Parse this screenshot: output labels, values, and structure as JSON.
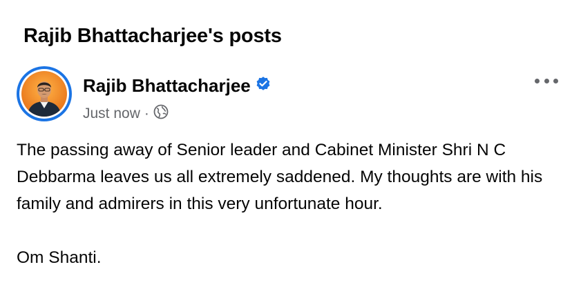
{
  "page": {
    "heading": "Rajib Bhattacharjee's posts"
  },
  "post": {
    "author": {
      "name": "Rajib Bhattacharjee",
      "verified": true,
      "avatar_icon": "profile-photo"
    },
    "timestamp": "Just now",
    "separator": "·",
    "privacy_icon": "globe-icon",
    "more_icon": "more-options-icon",
    "body": {
      "paragraph_1": "The passing away of Senior leader and Cabinet Minister Shri N C Debbarma leaves us all extremely saddened. My thoughts are with his family and admirers in this very unfortunate hour.",
      "paragraph_2": "Om Shanti."
    }
  },
  "colors": {
    "text_primary": "#050505",
    "text_secondary": "#65676b",
    "accent_blue": "#1b74e4",
    "avatar_background": "#f28a1c"
  }
}
